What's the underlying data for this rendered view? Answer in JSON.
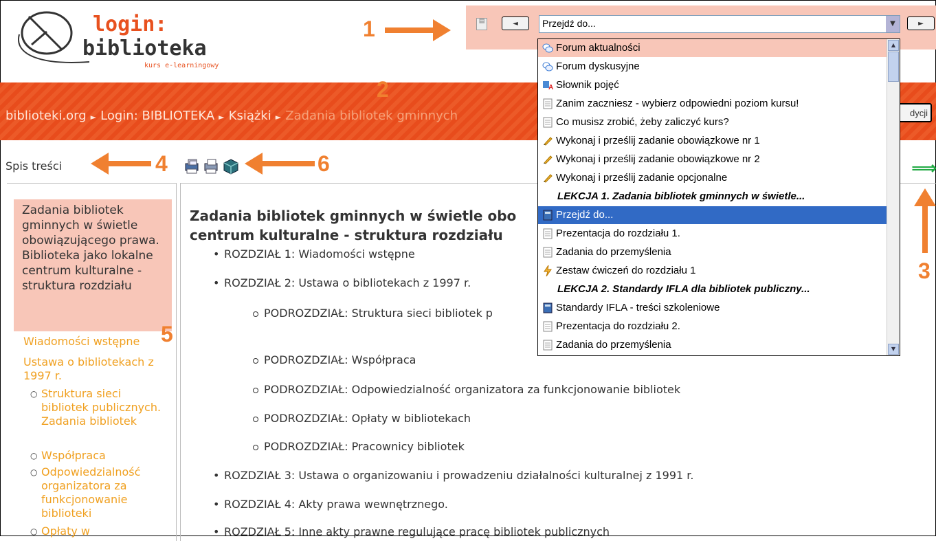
{
  "logo": {
    "line1": "login:",
    "line2": "biblioteka",
    "sub": "kurs e-learningowy"
  },
  "nav": {
    "prev_label": "◄",
    "next_label": "►",
    "jump_select_value": "Przejdź do..."
  },
  "annotations": {
    "a1": "1",
    "a2": "2",
    "a3": "3",
    "a4": "4",
    "a5": "5",
    "a6": "6"
  },
  "breadcrumb": {
    "items": [
      "biblioteki.org",
      "Login: BIBLIOTEKA",
      "Książki",
      "Zadania bibliotek gminnych"
    ],
    "separator": "►"
  },
  "edit_button_label": "dycji",
  "toc": {
    "label": "Spis treści",
    "active": "Zadania bibliotek gminnych w świetle obowiązującego prawa. Biblioteka jako lokalne centrum kulturalne - struktura rozdziału",
    "links": [
      "Wiadomości wstępne",
      "Ustawa o bibliotekach z 1997 r."
    ],
    "sublinks": [
      "Struktura sieci bibliotek publicznych. Zadania bibliotek",
      "Współpraca",
      "Odpowiedzialność organizatora za funkcjonowanie biblioteki",
      "Opłaty w"
    ]
  },
  "content": {
    "title_line1": "Zadania bibliotek gminnych w świetle obo",
    "title_line2": "centrum kulturalne - struktura rozdziału",
    "items": [
      "ROZDZIAŁ 1: Wiadomości wstępne",
      "ROZDZIAŁ 2: Ustawa o bibliotekach z 1997 r.",
      "ROZDZIAŁ 3: Ustawa o organizowaniu i prowadzeniu działalności kulturalnej z 1991 r.",
      "ROZDZIAŁ 4: Akty prawa wewnętrznego.",
      "ROZDZIAŁ 5: Inne akty prawne regulujące pracę bibliotek publicznych"
    ],
    "subitems": [
      "PODROZDZIAŁ: Struktura sieci bibliotek p",
      "PODROZDZIAŁ: Współpraca",
      "PODROZDZIAŁ: Odpowiedzialność organizatora za funkcjonowanie bibliotek",
      "PODROZDZIAŁ: Opłaty w bibliotekach",
      "PODROZDZIAŁ: Pracownicy bibliotek"
    ]
  },
  "dropdown": {
    "items": [
      {
        "label": "Forum aktualności",
        "icon": "forum-icon"
      },
      {
        "label": "Forum dyskusyjne",
        "icon": "forum-icon"
      },
      {
        "label": "Słownik pojęć",
        "icon": "glossary-icon"
      },
      {
        "label": "Zanim zaczniesz - wybierz odpowiedni poziom kursu!",
        "icon": "page-icon"
      },
      {
        "label": "Co musisz zrobić, żeby zaliczyć kurs?",
        "icon": "page-icon"
      },
      {
        "label": "Wykonaj i prześlij zadanie obowiązkowe nr 1",
        "icon": "assignment-icon"
      },
      {
        "label": "Wykonaj i prześlij zadanie obowiązkowe nr 2",
        "icon": "assignment-icon"
      },
      {
        "label": "Wykonaj i prześlij zadanie opcjonalne",
        "icon": "assignment-icon"
      },
      {
        "group": "LEKCJA 1. Zadania bibliotek gminnych w świetle..."
      },
      {
        "label": "Przejdź do...",
        "icon": "book-icon",
        "selected": true
      },
      {
        "label": "Prezentacja do rozdziału 1.",
        "icon": "page-icon"
      },
      {
        "label": "Zadania do przemyślenia",
        "icon": "page-icon"
      },
      {
        "label": "Zestaw ćwiczeń do rozdziału 1",
        "icon": "quiz-icon"
      },
      {
        "group": "LEKCJA 2. Standardy IFLA dla bibliotek publiczny..."
      },
      {
        "label": "Standardy IFLA - treści szkoleniowe",
        "icon": "book-icon"
      },
      {
        "label": "Prezentacja do rozdziału 2.",
        "icon": "page-icon"
      },
      {
        "label": "Zadania do przemyślenia",
        "icon": "page-icon"
      }
    ]
  },
  "colors": {
    "accent_orange": "#f08030",
    "breadcrumb_bar": "#e84c1c",
    "highlight_pink": "#f8c6b8",
    "toc_link": "#f0a020",
    "selected_blue": "#316ac5"
  }
}
